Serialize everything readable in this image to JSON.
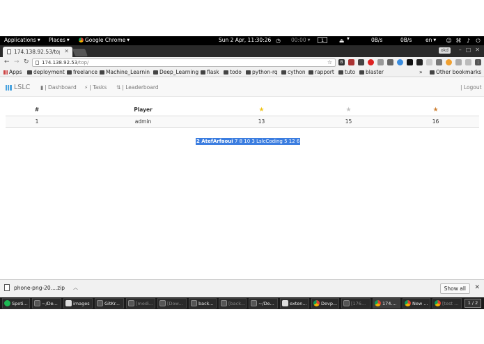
{
  "gnome_panel": {
    "applications": "Applications",
    "places": "Places",
    "app": "Google Chrome",
    "datetime": "Sun  2 Apr, 11:30:26",
    "timer": "00:00",
    "workspace": "1",
    "net_down": "0B/s",
    "net_up": "0B/s",
    "lang": "en"
  },
  "browser": {
    "tab_title": "174.138.92.53/top/",
    "user_chip": "okd",
    "url_host": "174.138.92.53",
    "url_path": "/top/",
    "bookmarks": [
      {
        "label": "Apps"
      },
      {
        "label": "deployment"
      },
      {
        "label": "freelance"
      },
      {
        "label": "Machine_Learnin"
      },
      {
        "label": "Deep_Learning"
      },
      {
        "label": "flask"
      },
      {
        "label": "todo"
      },
      {
        "label": "python-rq"
      },
      {
        "label": "cython"
      },
      {
        "label": "rapport"
      },
      {
        "label": "tuto"
      },
      {
        "label": "blaster"
      },
      {
        "label": "Other bookmarks"
      }
    ]
  },
  "site": {
    "brand": "LSLC",
    "nav": {
      "dashboard": "| Dashboard",
      "tasks": "| Tasks",
      "leaderboard": "| Leaderboard",
      "logout": "| Logout"
    },
    "table": {
      "headers": {
        "rank": "#",
        "player": "Player"
      },
      "rows": [
        {
          "rank": "1",
          "player": "admin",
          "gold": "13",
          "silver": "15",
          "bronze": "16"
        }
      ]
    },
    "selected_text": {
      "bold": "2 AtefArfaoui",
      "rest": " 7 8 10 3 LslcCoding 5 12 6"
    }
  },
  "download_shelf": {
    "file": "phone-png-20....zip",
    "show_all": "Show all"
  },
  "taskbar": {
    "tasks": [
      "Spoti...",
      "~/De...",
      "images",
      "GitKr...",
      "[medi...",
      "[Dow...",
      "back...",
      "[back...",
      "~/De...",
      "exten...",
      "Devp...",
      "[176...",
      "174....",
      "New ...",
      "[test ..."
    ],
    "pager": "1 / 2"
  }
}
